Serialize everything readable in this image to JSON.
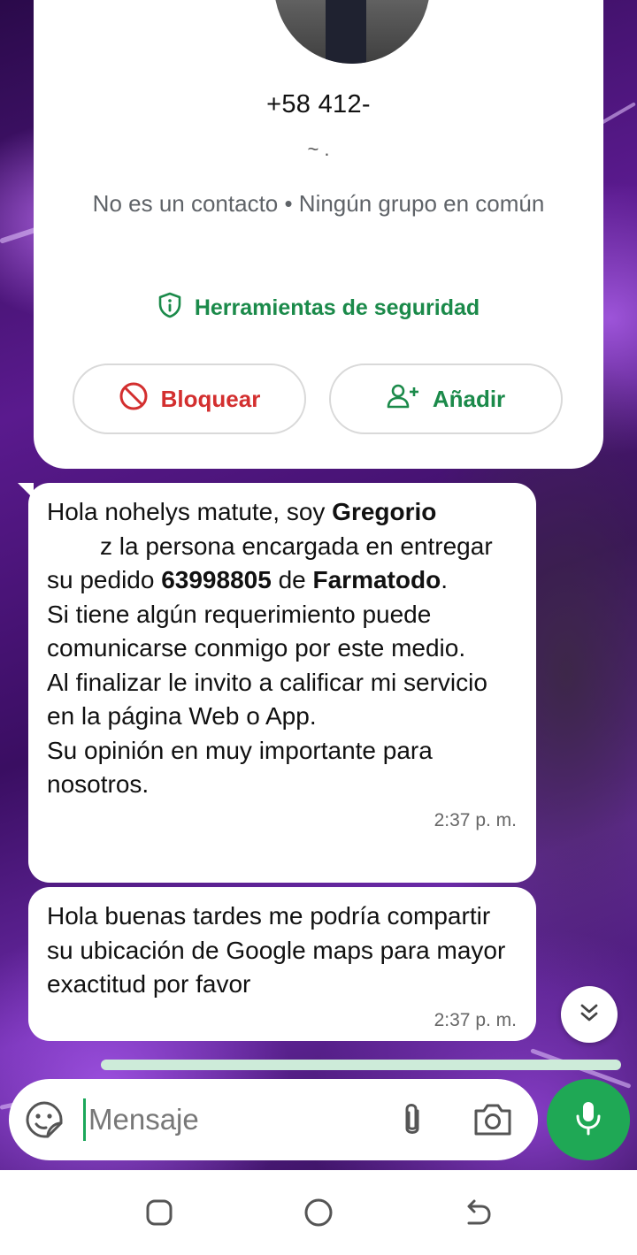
{
  "contact": {
    "phone": "+58 412-",
    "about": "~ .",
    "meta": "No es un contacto • Ningún grupo en común",
    "security_label": "Herramientas de seguridad",
    "block_label": "Bloquear",
    "add_label": "Añadir"
  },
  "messages": [
    {
      "parts": [
        "Hola nohelys matute, soy ",
        "Gregorio",
        "z la persona encargada en entregar su pedido ",
        "63998805",
        " de ",
        "Farmatodo",
        ".\nSi tiene algún requerimiento puede comunicarse conmigo por este medio.\nAl finalizar le invito a calificar mi servicio en la página Web o App.\nSu opinión en muy importante para nosotros."
      ],
      "time": "2:37 p. m."
    },
    {
      "text": "Hola buenas tardes me podría compartir su ubicación de Google maps para mayor exactitud por favor",
      "time": "2:37 p. m."
    }
  ],
  "composer": {
    "placeholder": "Mensaje"
  },
  "icons": {
    "security": "shield-info-icon",
    "block": "block-icon",
    "add": "add-person-icon",
    "scroll": "double-chevron-down-icon",
    "emoji": "sticker-icon",
    "attach": "paperclip-icon",
    "camera": "camera-icon",
    "mic": "microphone-icon"
  },
  "colors": {
    "accent_green": "#1fa855",
    "security_green": "#1b8a4a",
    "block_red": "#d32f2f"
  }
}
